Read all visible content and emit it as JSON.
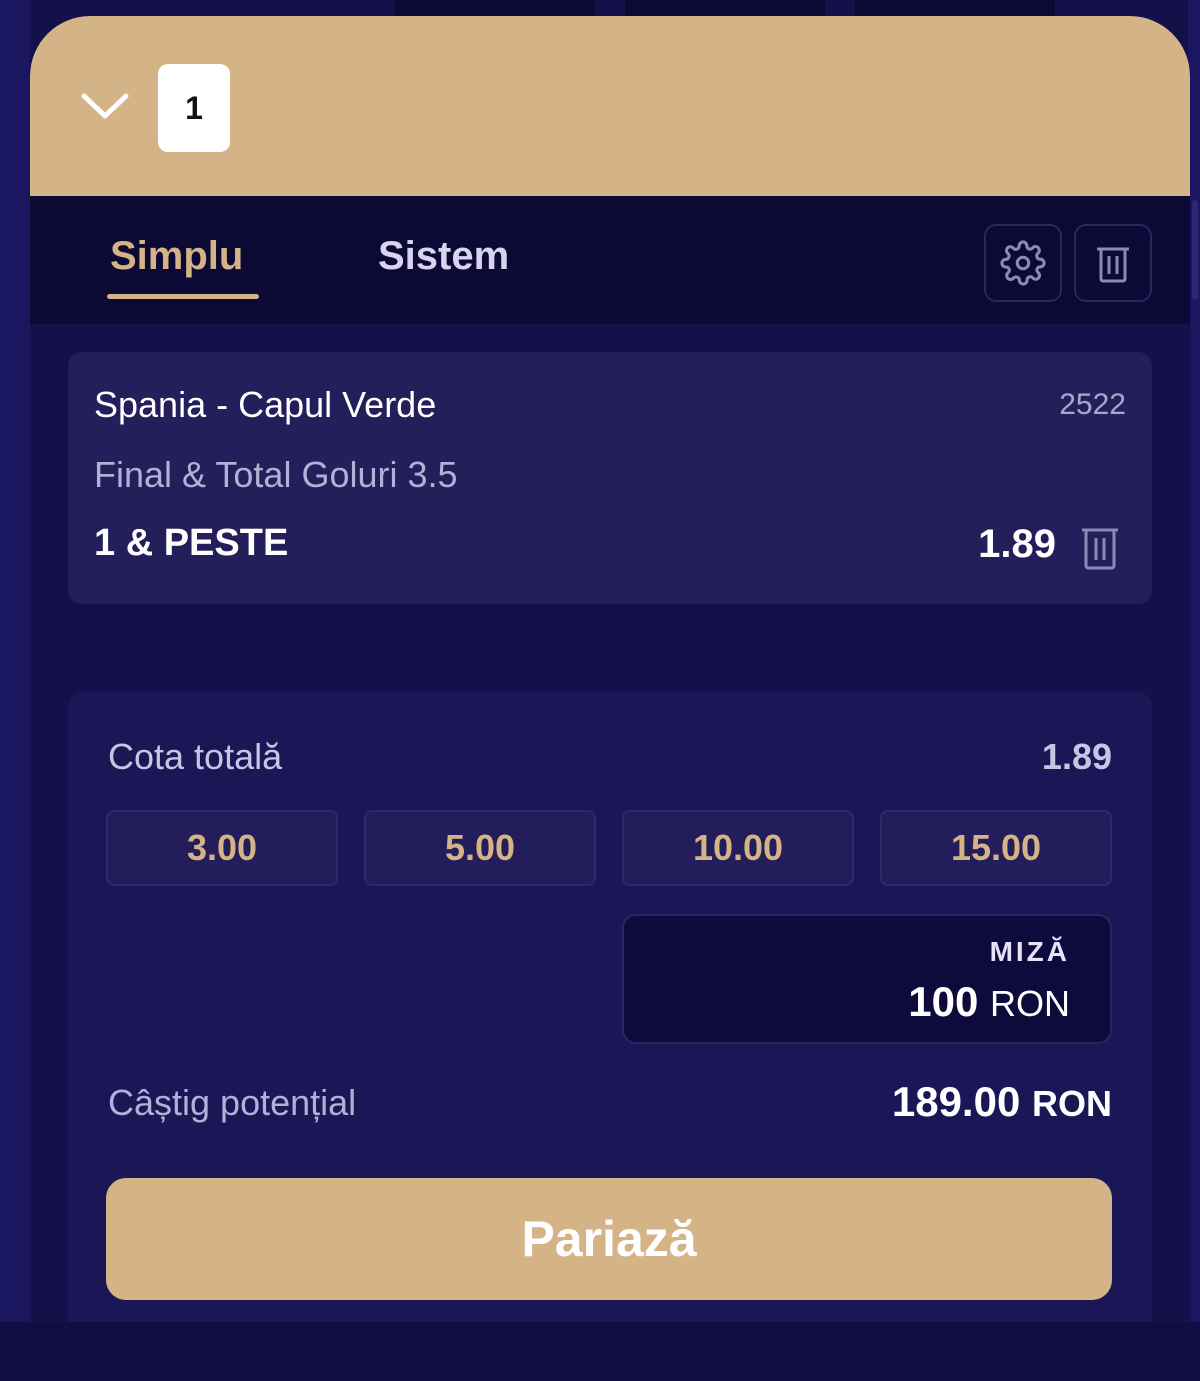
{
  "header": {
    "selection_count": "1"
  },
  "tabs": [
    {
      "label": "Simplu",
      "active": true
    },
    {
      "label": "Sistem",
      "active": false
    }
  ],
  "icons": {
    "settings": "gear-icon",
    "clear_all": "trash-icon",
    "remove_selection": "trash-icon",
    "toggle": "chevron-down-icon"
  },
  "selection": {
    "match": "Spania - Capul Verde",
    "code": "2522",
    "market": "Final & Total Goluri 3.5",
    "pick": "1 & PESTE",
    "odds": "1.89"
  },
  "stake_panel": {
    "total_odds_label": "Cota totală",
    "total_odds_value": "1.89",
    "quick_stakes": [
      "3.00",
      "5.00",
      "10.00",
      "15.00"
    ],
    "stake_label": "MIZĂ",
    "stake_amount": "100",
    "stake_currency": "RON",
    "potential_win_label": "Câștig potențial",
    "potential_win_amount": "189.00",
    "potential_win_currency": "RON",
    "bet_button_label": "Pariază"
  },
  "colors": {
    "accent": "#d4b486",
    "background": "#14104a",
    "card": "#241f5a"
  }
}
